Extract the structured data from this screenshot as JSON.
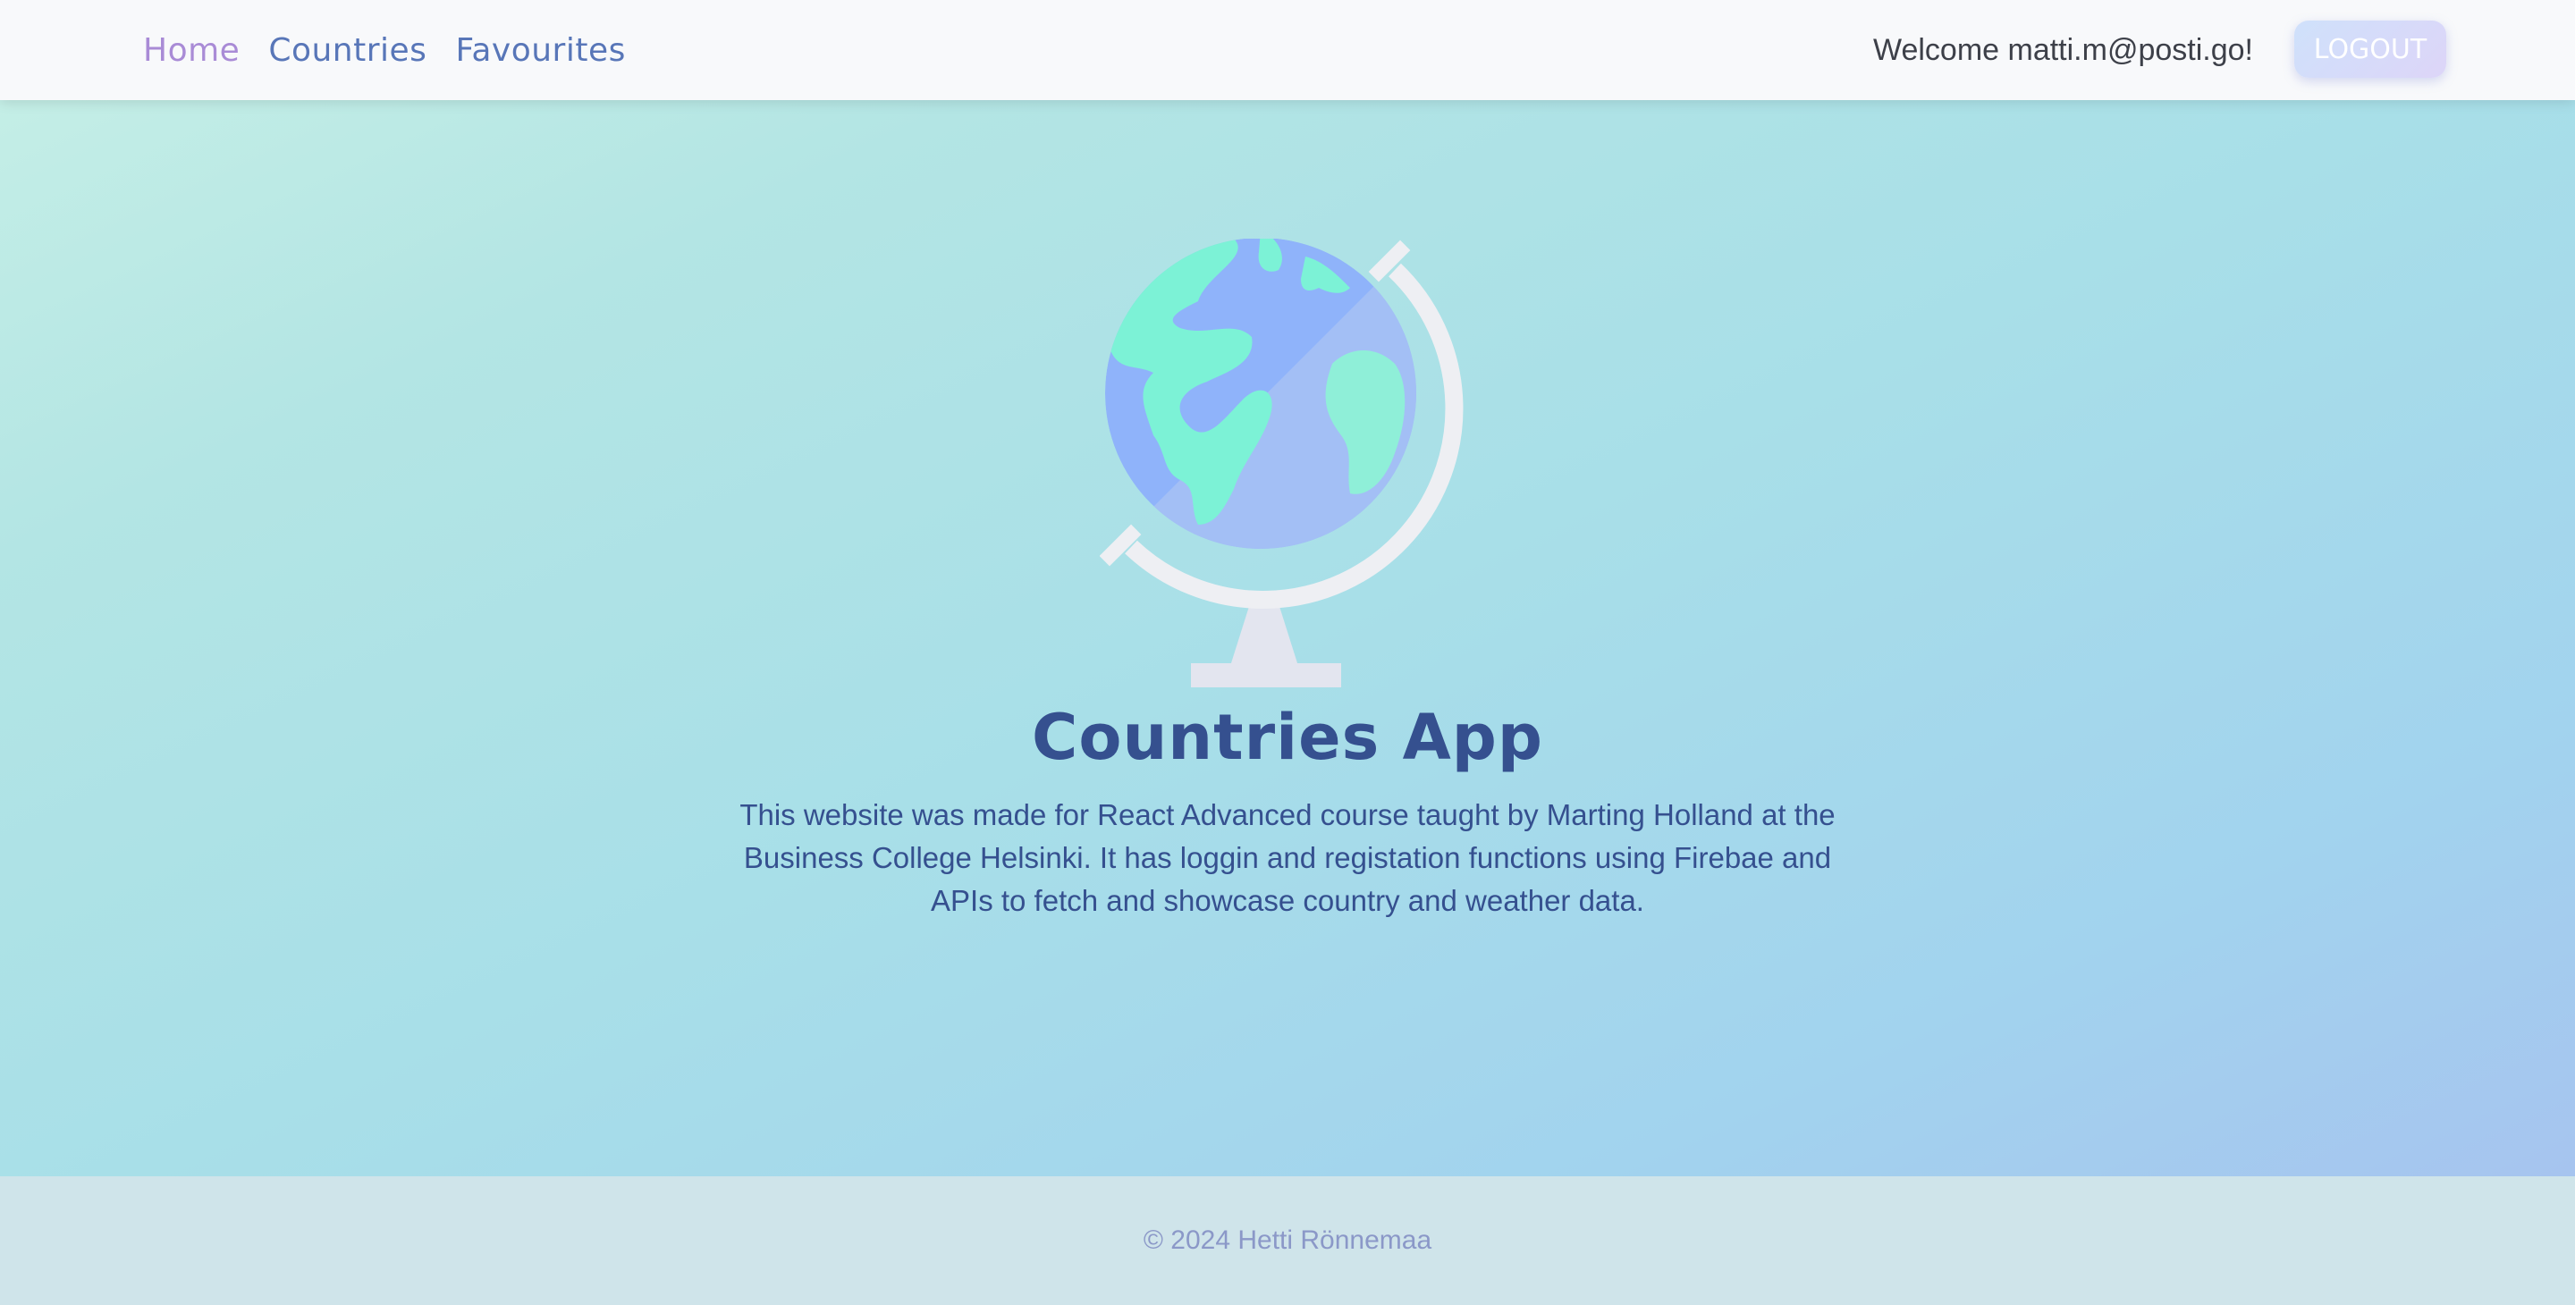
{
  "nav": {
    "links": [
      {
        "label": "Home",
        "active": true
      },
      {
        "label": "Countries",
        "active": false
      },
      {
        "label": "Favourites",
        "active": false
      }
    ],
    "welcome": "Welcome matti.m@posti.go!",
    "logout_label": "LOGOUT"
  },
  "hero": {
    "icon": "globe-icon",
    "title": "Countries App",
    "description": "This website was made for React Advanced course taught by Marting Holland at the Business College Helsinki. It has loggin and registation functions using Firebae and APIs to fetch and showcase country and weather data."
  },
  "footer": {
    "copyright": "© 2024 Hetti Rönnemaa"
  },
  "colors": {
    "accent": "#35508f",
    "nav_link": "#5876b8",
    "nav_active": "#a98bd6",
    "hero_gradient_start": "#c4eee6",
    "hero_gradient_end": "#a6c4ef",
    "footer_bg": "#cfe4ea"
  }
}
